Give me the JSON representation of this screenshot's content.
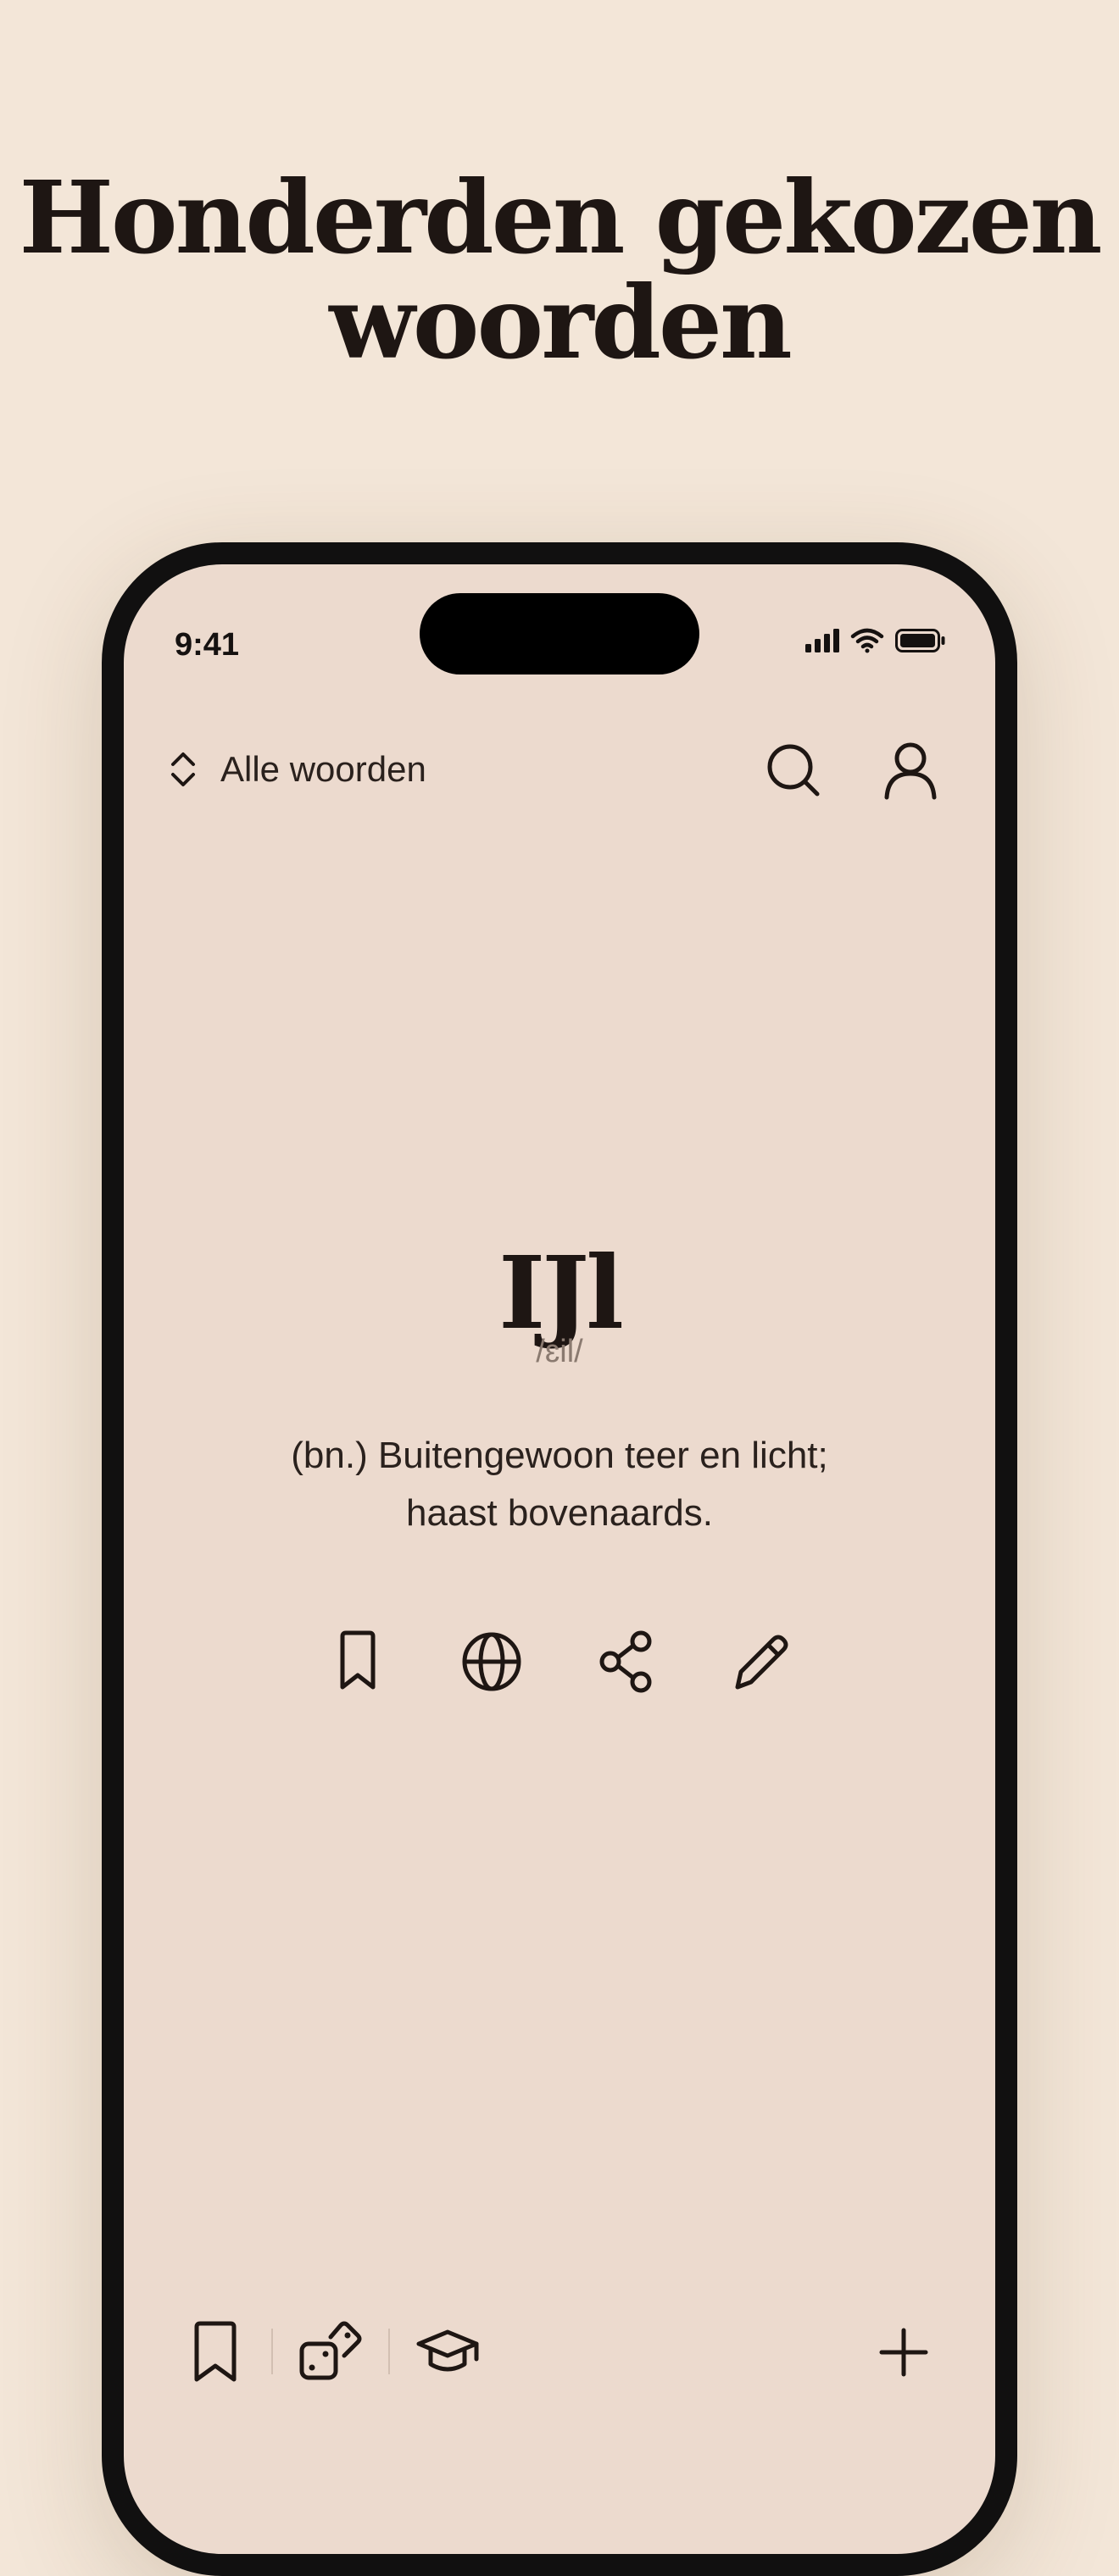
{
  "headline": {
    "line1": "Honderden gekozen",
    "line2": "woorden"
  },
  "status_bar": {
    "time": "9:41",
    "icons": [
      "cellular-signal-icon",
      "wifi-icon",
      "battery-icon"
    ]
  },
  "top_bar": {
    "list_switch_label": "Alle woorden",
    "list_switch_icon": "chevron-up-down-icon",
    "search_icon": "search-icon",
    "profile_icon": "user-icon"
  },
  "word_card": {
    "word": "IJl",
    "phonetic": "/ɛil/",
    "definition_line1": "(bn.) Buitengewoon teer en licht;",
    "definition_line2": "haast bovenaards.",
    "actions": [
      "bookmark-icon",
      "globe-icon",
      "share-icon",
      "pencil-icon"
    ]
  },
  "bottom_bar": {
    "items": [
      "bookmark-icon",
      "dice-icon",
      "graduation-cap-icon",
      "plus-icon"
    ]
  },
  "colors": {
    "background": "#f3e6d8",
    "screen": "#ecdace",
    "frame": "#111010",
    "text": "#1e1613",
    "muted": "#8a7a70"
  }
}
